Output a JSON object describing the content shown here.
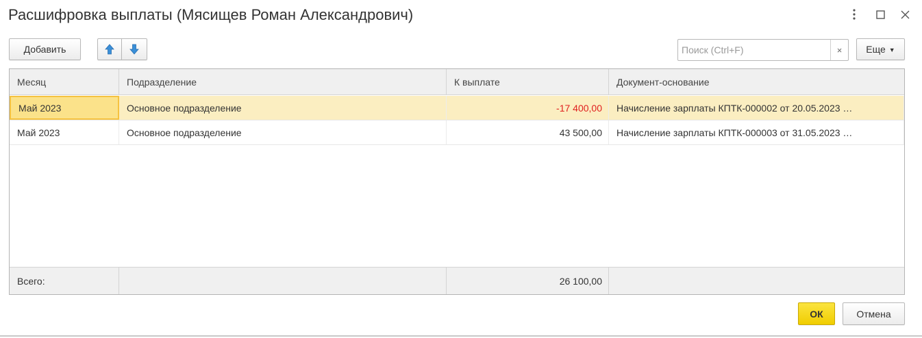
{
  "window": {
    "title": "Расшифровка выплаты (Мясищев Роман Александрович)"
  },
  "toolbar": {
    "add_label": "Добавить",
    "more_label": "Еще",
    "search_placeholder": "Поиск (Ctrl+F)",
    "search_clear": "×"
  },
  "table": {
    "headers": [
      "Месяц",
      "Подразделение",
      "К выплате",
      "Документ-основание"
    ],
    "rows": [
      {
        "month": "Май 2023",
        "department": "Основное подразделение",
        "amount": "-17 400,00",
        "document": "Начисление зарплаты КПТК-000002 от 20.05.2023 …"
      },
      {
        "month": "Май 2023",
        "department": "Основное подразделение",
        "amount": "43 500,00",
        "document": "Начисление зарплаты КПТК-000003 от 31.05.2023 …"
      }
    ],
    "footer": {
      "label": "Всего:",
      "total": "26 100,00"
    }
  },
  "actions": {
    "ok_label": "ОК",
    "cancel_label": "Отмена"
  },
  "colors": {
    "selected_row": "#fbeec1",
    "negative_amount": "#e02020",
    "ok_button": "#f5d600",
    "arrow_blue": "#3a8fd8"
  }
}
